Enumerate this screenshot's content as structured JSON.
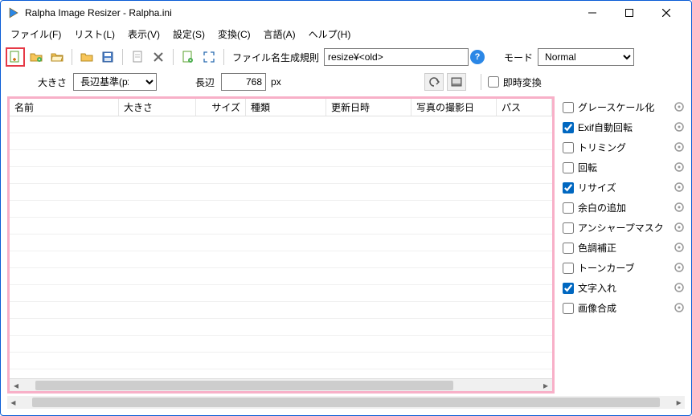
{
  "window": {
    "title": "Ralpha Image Resizer - Ralpha.ini"
  },
  "menu": {
    "file": "ファイル(F)",
    "list": "リスト(L)",
    "view": "表示(V)",
    "settings": "設定(S)",
    "convert": "変換(C)",
    "lang": "言語(A)",
    "help": "ヘルプ(H)"
  },
  "toolbar": {
    "rule_label": "ファイル名生成規則",
    "rule_value": "resize¥<old>",
    "mode_label": "モード",
    "mode_value": "Normal"
  },
  "sizebar": {
    "size_label": "大きさ",
    "size_select": "長辺基準(px)",
    "long_label": "長辺",
    "long_value": "768",
    "unit": "px",
    "instant_label": "即時変換"
  },
  "columns": {
    "name": "名前",
    "size": "大きさ",
    "filesize": "サイズ",
    "type": "種類",
    "modified": "更新日時",
    "shotdate": "写真の撮影日",
    "path": "パス"
  },
  "options": {
    "grayscale": "グレースケール化",
    "exif": "Exif自動回転",
    "trimming": "トリミング",
    "rotate": "回転",
    "resize": "リサイズ",
    "margin": "余白の追加",
    "unsharp": "アンシャープマスク",
    "color": "色調補正",
    "tone": "トーンカーブ",
    "text": "文字入れ",
    "compose": "画像合成"
  },
  "checked": {
    "grayscale": false,
    "exif": true,
    "trimming": false,
    "rotate": false,
    "resize": true,
    "margin": false,
    "unsharp": false,
    "color": false,
    "tone": false,
    "text": true,
    "compose": false
  }
}
